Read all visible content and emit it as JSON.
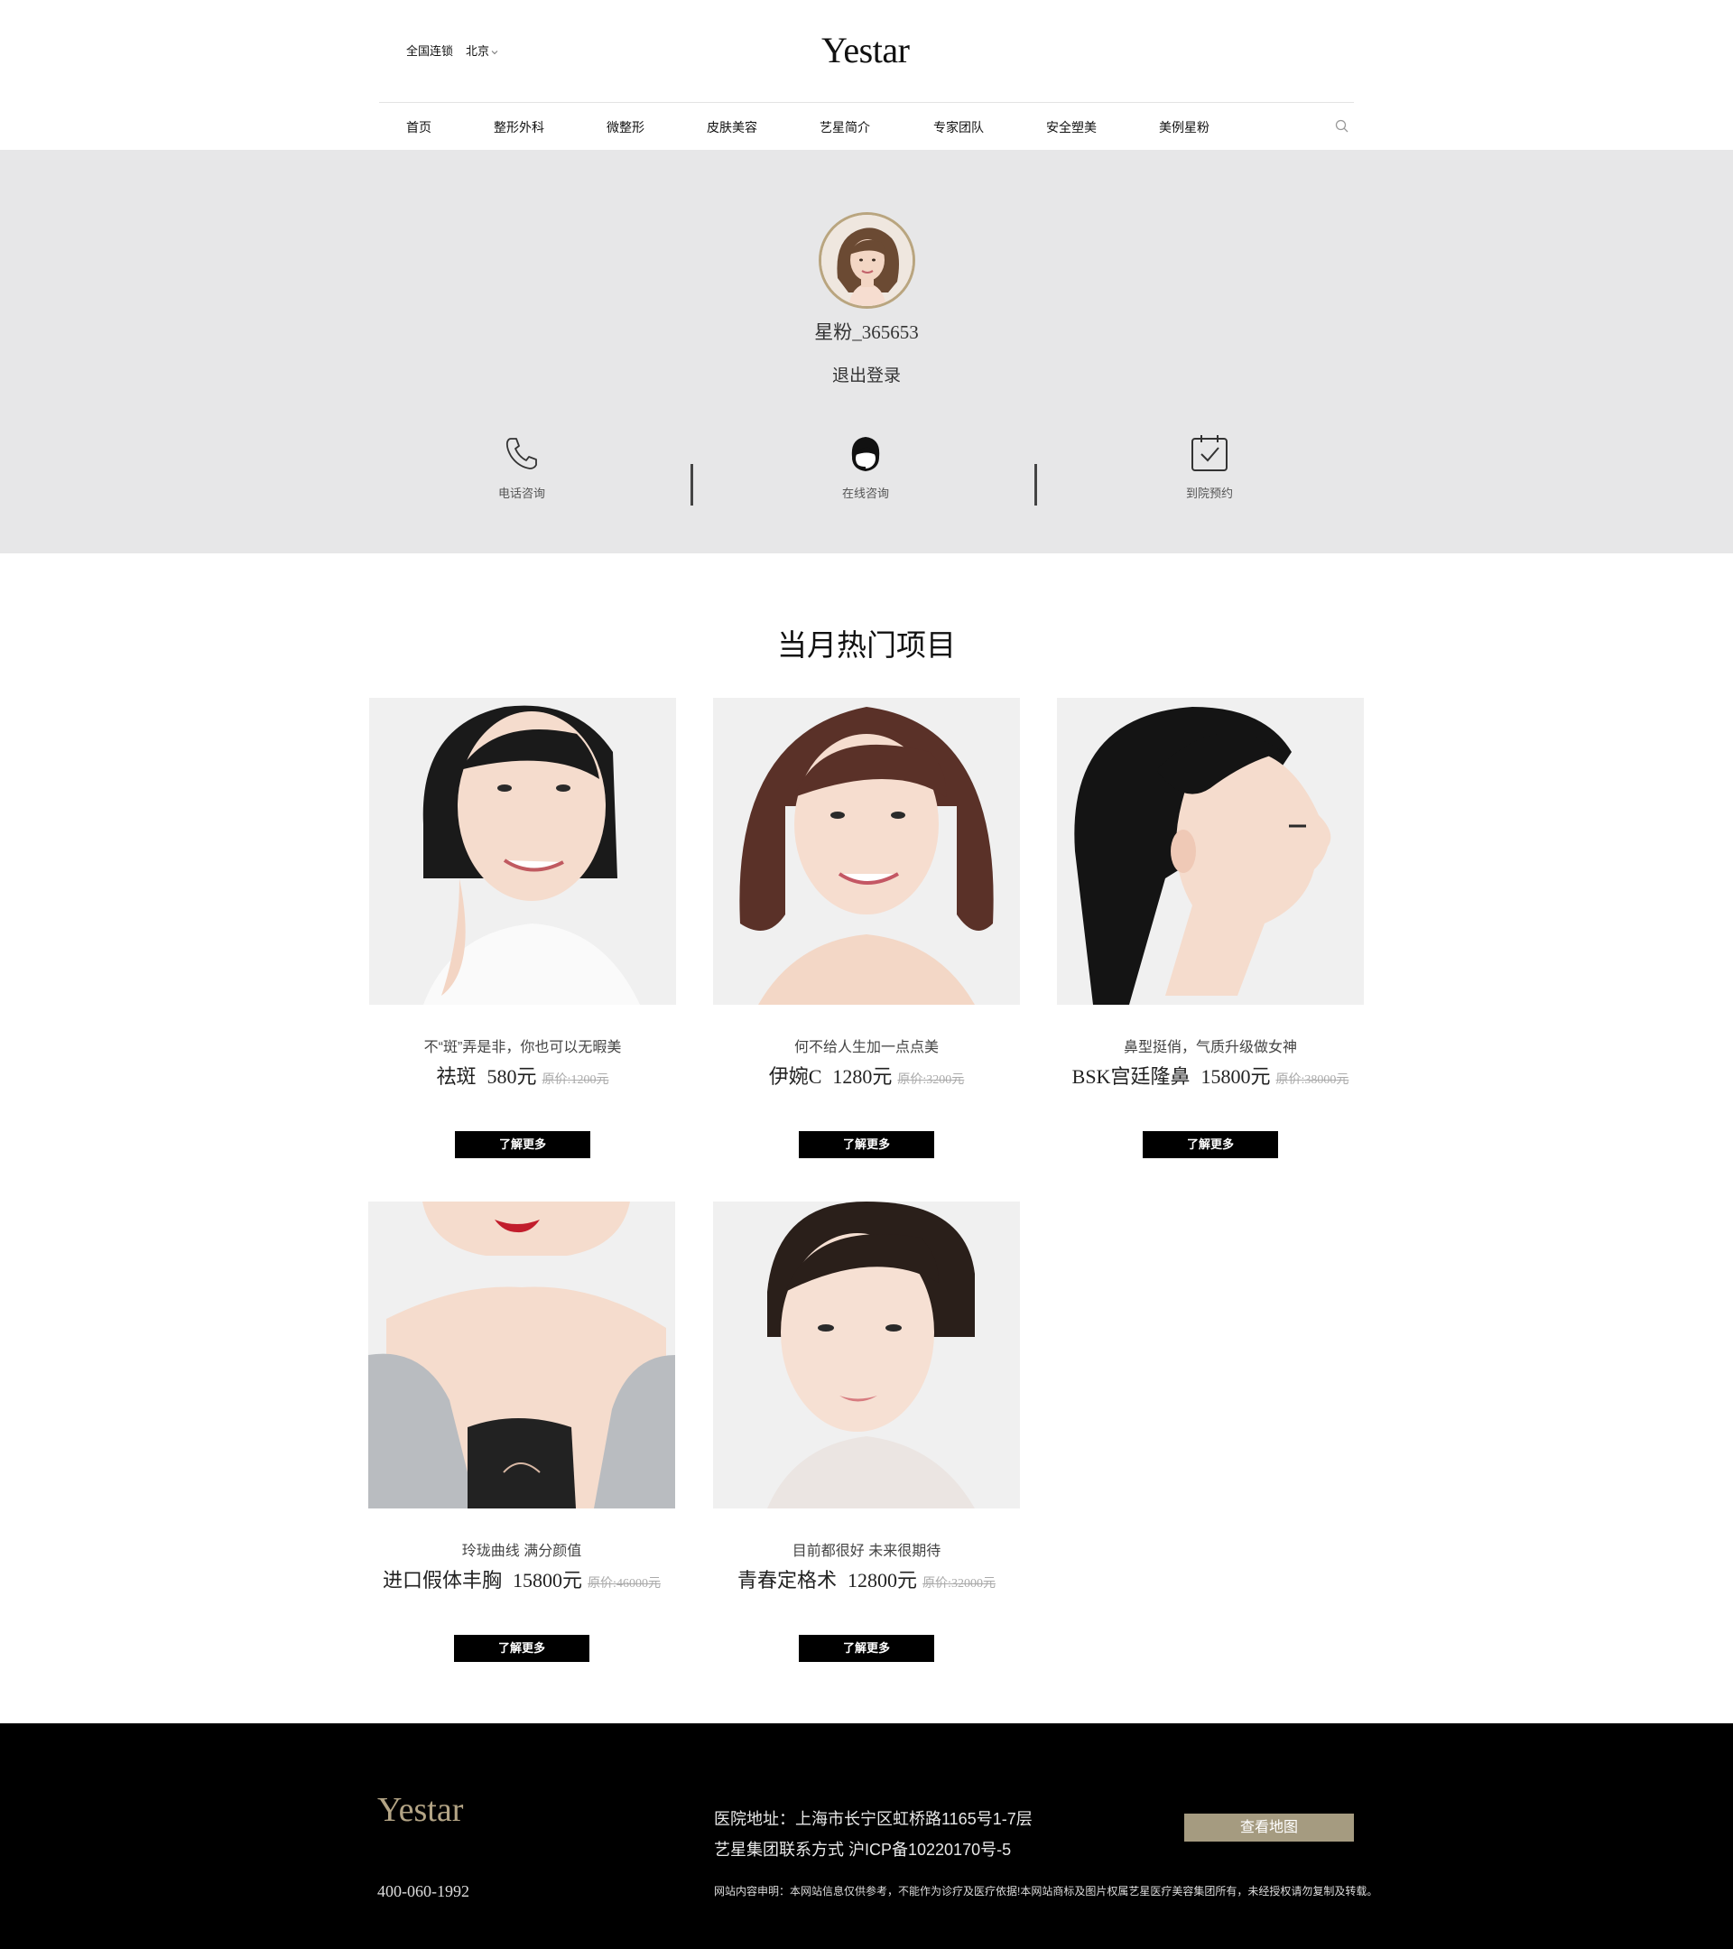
{
  "header": {
    "chain_label": "全国连锁",
    "city": "北京",
    "logo": "Yestar"
  },
  "nav": {
    "items": [
      "首页",
      "整形外科",
      "微整形",
      "皮肤美容",
      "艺星简介",
      "专家团队",
      "安全塑美",
      "美例星粉"
    ],
    "search_icon": "search-icon"
  },
  "profile": {
    "username": "星粉_365653",
    "logout": "退出登录",
    "services": [
      {
        "label": "电话咨询",
        "icon": "phone-icon"
      },
      {
        "label": "在线咨询",
        "icon": "headset-icon"
      },
      {
        "label": "到院预约",
        "icon": "calendar-check-icon"
      }
    ]
  },
  "hot": {
    "title": "当月热门项目",
    "more_label": "了解更多",
    "items": [
      {
        "tagline": "不“斑”弄是非，你也可以无暇美",
        "name": "祛斑",
        "price": "580元",
        "original": "原价:1200元"
      },
      {
        "tagline": "何不给人生加一点点美",
        "name": "伊婉C",
        "price": "1280元",
        "original": "原价:3200元"
      },
      {
        "tagline": "鼻型挺俏，气质升级做女神",
        "name": "BSK宫廷隆鼻",
        "price": "15800元",
        "original": "原价:38000元"
      },
      {
        "tagline": "玲珑曲线 满分颜值",
        "name": "进口假体丰胸",
        "price": "15800元",
        "original": "原价:46000元"
      },
      {
        "tagline": "目前都很好 未来很期待",
        "name": "青春定格术",
        "price": "12800元",
        "original": "原价:32000元"
      }
    ]
  },
  "footer": {
    "logo": "Yestar",
    "phone": "400-060-1992",
    "address": "医院地址：上海市长宁区虹桥路1165号1-7层",
    "contact": "艺星集团联系方式 沪ICP备10220170号-5",
    "map_button": "查看地图",
    "disclaimer": "网站内容申明：本网站信息仅供参考，不能作为诊疗及医疗依据!本网站商标及图片权属艺星医疗美容集团所有，未经授权请勿复制及转载。"
  },
  "colors": {
    "profile_bg": "#e7e7e8",
    "avatar_ring": "#b9a57f",
    "footer_logo": "#b3a485",
    "map_button_bg": "#a59b80",
    "button_bg": "#000000"
  }
}
